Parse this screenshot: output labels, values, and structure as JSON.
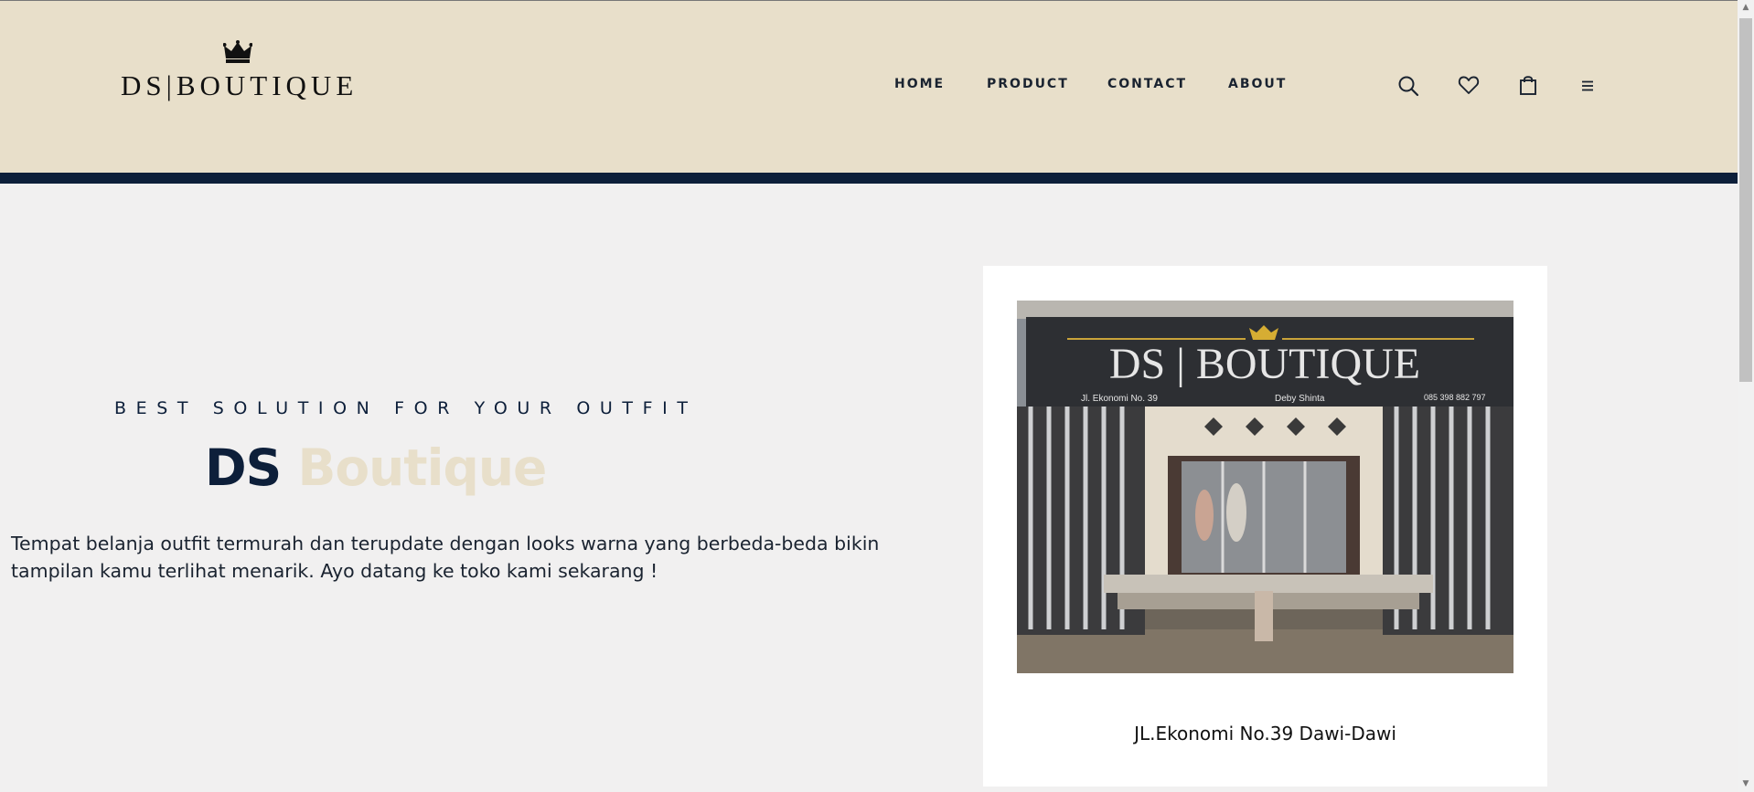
{
  "brand": {
    "logo_text": "DS|BOUTIQUE",
    "crown_icon": "crown-icon"
  },
  "nav": {
    "items": [
      "HOME",
      "PRODUCT",
      "CONTACT",
      "ABOUT"
    ]
  },
  "header_icons": [
    "search-icon",
    "heart-icon",
    "shopping-bag-icon",
    "menu-icon"
  ],
  "hero": {
    "tagline": "BEST SOLUTION FOR YOUR OUTFIT",
    "title_part1": "DS",
    "title_part2": "Boutique",
    "description": "Tempat belanja outfit termurah dan terupdate dengan looks warna yang berbeda-beda bikin tampilan kamu terlihat menarik. Ayo datang ke toko kami sekarang !"
  },
  "store_card": {
    "sign_text": "DS | BOUTIQUE",
    "sign_address": "Jl. Ekonomi No. 39",
    "sign_facebook": "Deby Shinta",
    "sign_phone": "085 398 882 797",
    "caption": "JL.Ekonomi No.39 Dawi-Dawi"
  },
  "colors": {
    "header_bg": "#e8dfca",
    "navy": "#0d1f3a",
    "page_bg": "#f1f0f0"
  }
}
